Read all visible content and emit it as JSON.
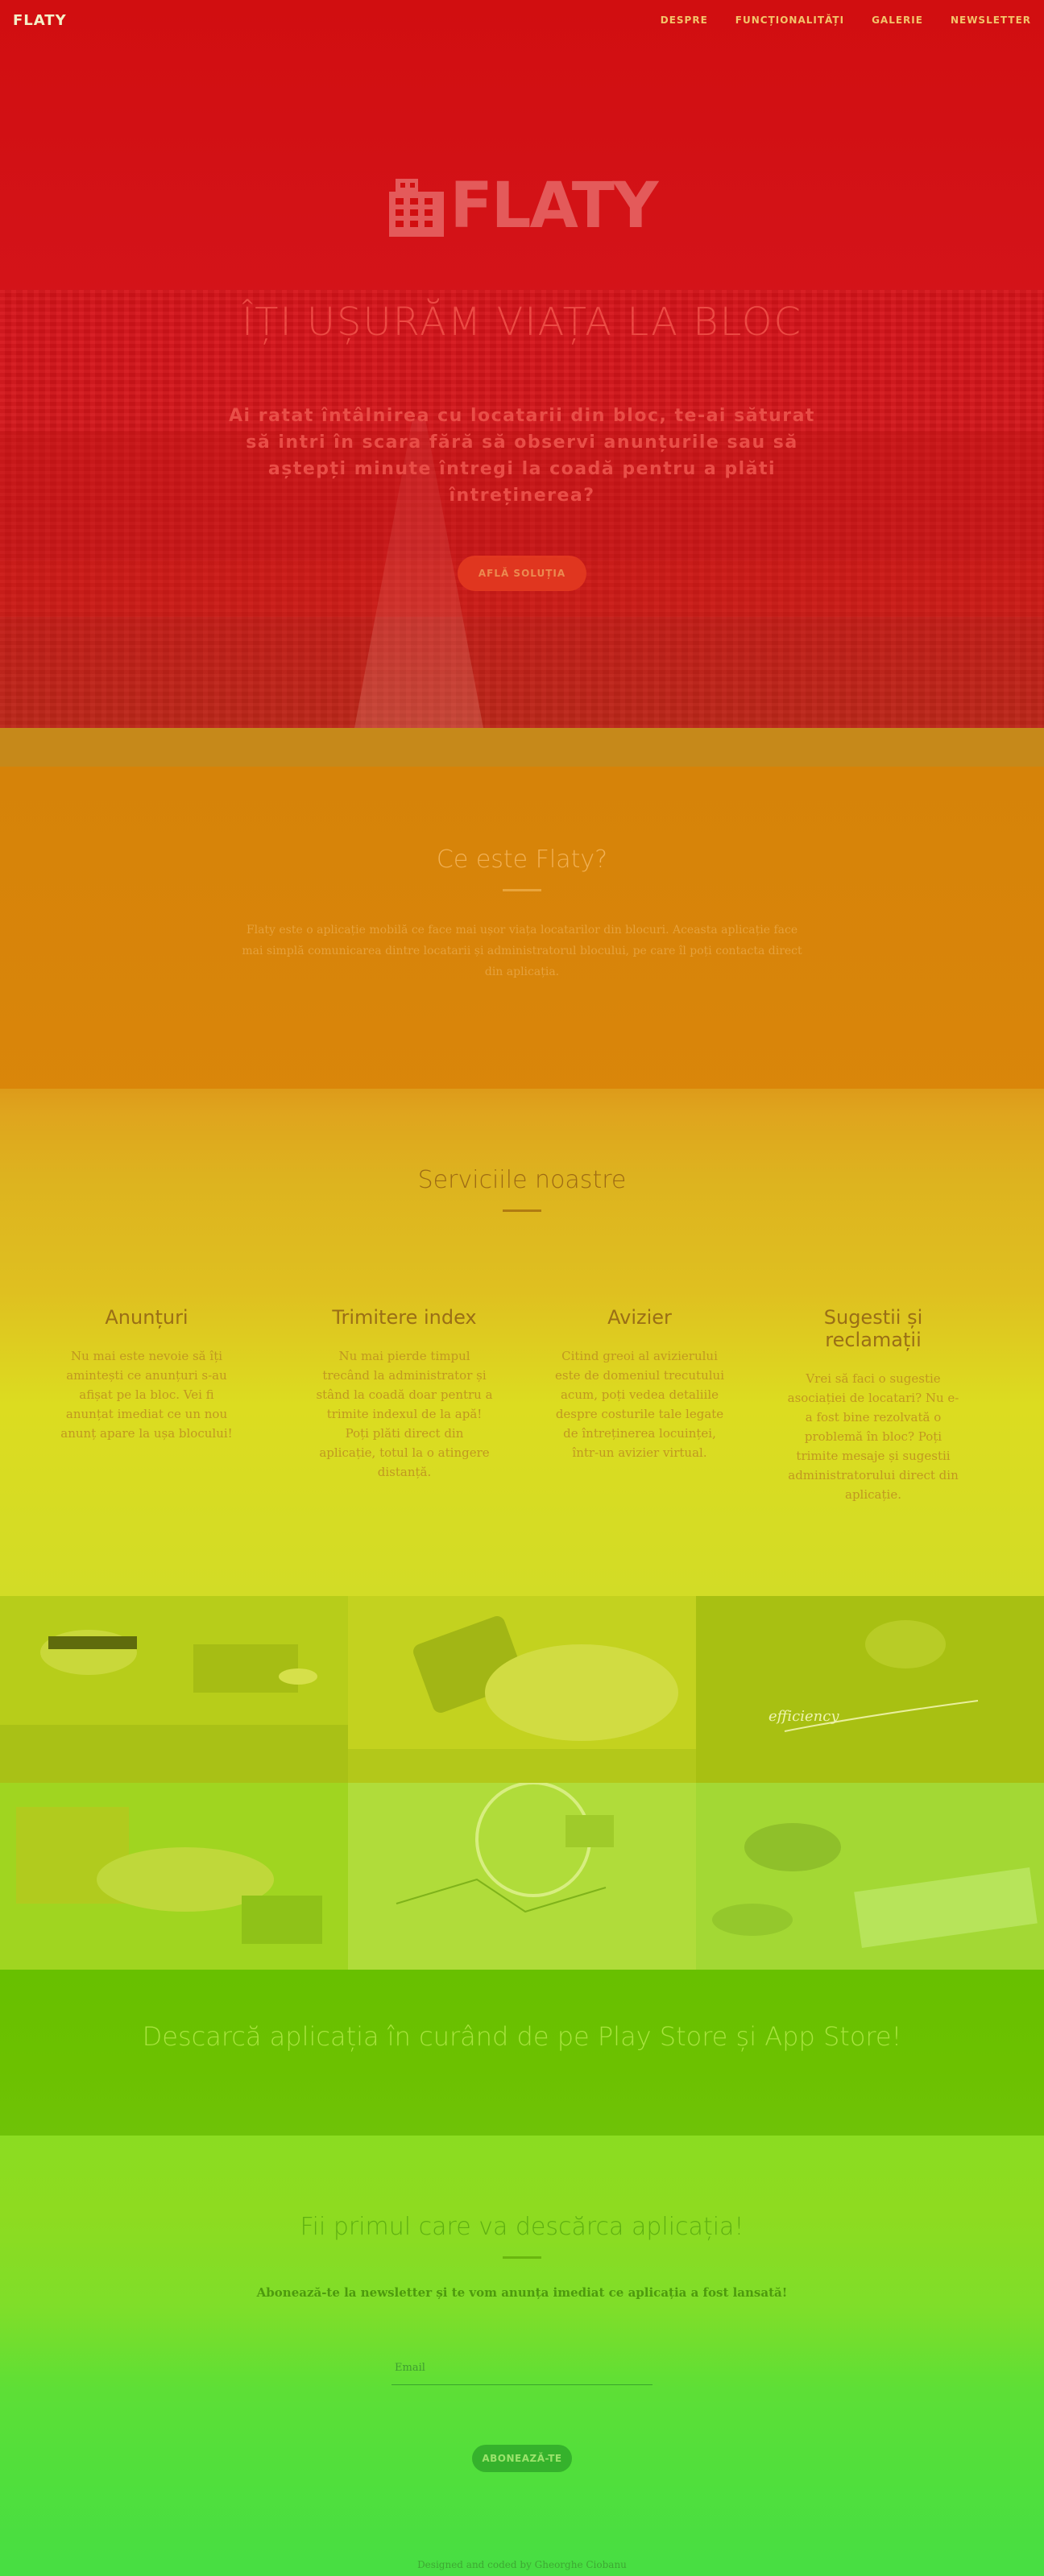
{
  "nav": {
    "brand": "FLATY",
    "links": [
      "DESPRE",
      "FUNCȚIONALITĂȚI",
      "GALERIE",
      "NEWSLETTER"
    ]
  },
  "hero": {
    "logo_text": "FLATY",
    "title": "ÎȚI UȘURĂM VIAȚA LA BLOC",
    "description": "Ai ratat întâlnirea cu locatarii din bloc, te-ai săturat să intri în scara fără să observi anunțurile sau să aștepți minute întregi la coadă pentru a plăti întreținerea?",
    "cta_label": "AFLĂ SOLUȚIA"
  },
  "about": {
    "title": "Ce este Flaty?",
    "text": "Flaty este o aplicație mobilă ce face mai ușor viața locatarilor din blocuri. Aceasta aplicație face mai simplă comunicarea dintre locatarii și administratorul blocului, pe care îl poți contacta direct din aplicația."
  },
  "services": {
    "title": "Serviciile noastre",
    "items": [
      {
        "title": "Anunțuri",
        "text": "Nu mai este nevoie să îți amintești ce anunțuri s-au afișat pe la bloc. Vei fi anunțat imediat ce un nou anunț apare la ușa blocului!"
      },
      {
        "title": "Trimitere index",
        "text": "Nu mai pierde timpul trecând la administrator și stând la coadă doar pentru a trimite indexul de la apă! Poți plăti direct din aplicație, totul la o atingere distanță."
      },
      {
        "title": "Avizier",
        "text": "Citind greoi al avizierului este de domeniul trecutului acum, poți vedea detaliile despre costurile tale legate de întreținerea locuinței, într-un avizier virtual."
      },
      {
        "title": "Sugestii și reclamații",
        "text": "Vrei să faci o sugestie asociației de locatari? Nu e-a fost bine rezolvată o problemă în bloc? Poți trimite mesaje și sugestii administratorului direct din aplicație."
      }
    ]
  },
  "download": {
    "text": "Descarcă aplicația în curând de pe Play Store și App Store!"
  },
  "newsletter": {
    "title": "Fii primul care va descărca aplicația!",
    "subtitle": "Abonează-te la newsletter și te vom anunța imediat ce aplicația a fost lansată!",
    "email_placeholder": "Email",
    "button_label": "ABONEAZĂ-TE",
    "footer": "Designed and coded by Gheorghe Ciobanu"
  },
  "colors": {
    "hero": "#d10e10",
    "about": "#da860a",
    "services": "#dfc020",
    "download": "#6cc100",
    "newsletter": "#50df3c"
  }
}
